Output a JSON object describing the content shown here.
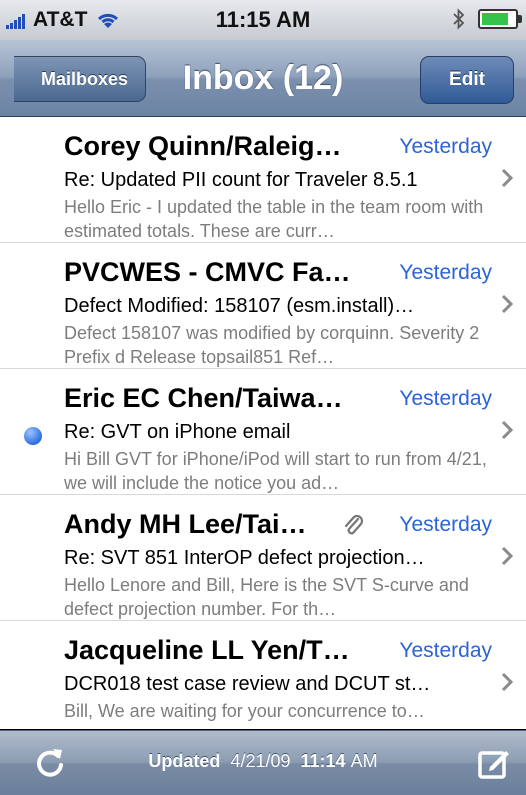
{
  "status_bar": {
    "carrier": "AT&T",
    "time": "11:15 AM"
  },
  "nav": {
    "back_label": "Mailboxes",
    "title": "Inbox (12)",
    "edit_label": "Edit"
  },
  "messages": [
    {
      "sender": "Corey Quinn/Raleig…",
      "date": "Yesterday",
      "subject": "Re: Updated PII count for Traveler 8.5.1",
      "preview": "Hello Eric - I updated the table in the team room with estimated totals. These are curr…",
      "unread": false,
      "attachment": false
    },
    {
      "sender": "PVCWES - CMVC Fa…",
      "date": "Yesterday",
      "subject": "Defect Modified: 158107 (esm.install)…",
      "preview": "Defect 158107 was modified by corquinn. Severity 2 Prefix d Release topsail851 Ref…",
      "unread": false,
      "attachment": false
    },
    {
      "sender": "Eric EC Chen/Taiwa…",
      "date": "Yesterday",
      "subject": "Re: GVT on iPhone email",
      "preview": "Hi Bill GVT for iPhone/iPod will start to run from 4/21, we will include the notice you ad…",
      "unread": true,
      "attachment": false
    },
    {
      "sender": "Andy MH Lee/Tai…",
      "date": "Yesterday",
      "subject": "Re: SVT 851 InterOP defect projection…",
      "preview": "Hello Lenore and Bill, Here is the SVT S-curve and defect projection number. For th…",
      "unread": false,
      "attachment": true
    },
    {
      "sender": "Jacqueline LL Yen/T…",
      "date": "Yesterday",
      "subject": "DCR018 test case review and DCUT st…",
      "preview": "Bill, We are waiting for your concurrence to…",
      "unread": false,
      "attachment": false
    }
  ],
  "toolbar": {
    "updated_label": "Updated",
    "updated_date": "4/21/09",
    "updated_time": "11:14",
    "updated_ampm": "AM"
  },
  "colors": {
    "accent_blue": "#2a64d6",
    "nav_bar": "#8ea1bb",
    "unread_dot": "#2d6fe0"
  }
}
